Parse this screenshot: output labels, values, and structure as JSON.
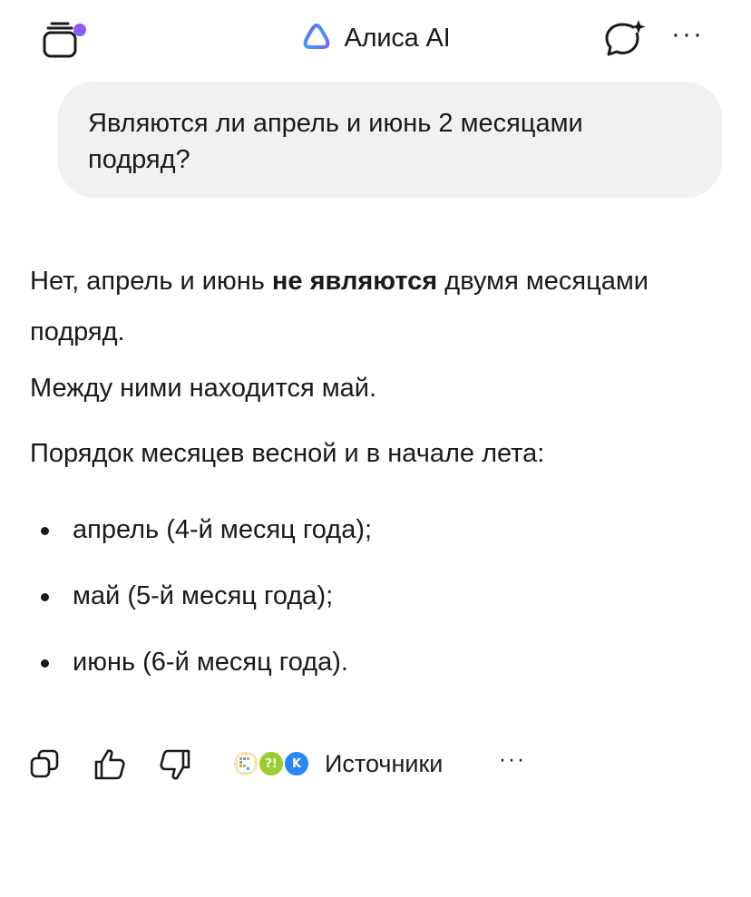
{
  "header": {
    "title": "Алиса AI",
    "chats_icon": "chats-stack-icon",
    "logo_icon": "alice-logo-icon",
    "new_chat_icon": "new-chat-sparkle-icon",
    "more_label": "···",
    "accent_color": "#8b5cf6"
  },
  "user_message": {
    "text": "Являются ли апрель и июнь 2 месяцами подряд?"
  },
  "answer": {
    "para1_before": "Нет, апрель и июнь ",
    "para1_bold": "не являются",
    "para1_after": " двумя месяцами подряд.",
    "para2": "Между ними находится май.",
    "para3": "Порядок месяцев весной и в начале лета:",
    "bullets": [
      "апрель (4-й месяц года);",
      "май (5-й месяц года);",
      "июнь (6-й месяц года)."
    ]
  },
  "actions": {
    "copy_icon": "copy-icon",
    "like_icon": "thumbs-up-icon",
    "dislike_icon": "thumbs-down-icon",
    "sources_label": "Источники",
    "source_icons": [
      "source-site-icon",
      "source-quiz-icon",
      "vk-icon"
    ],
    "vk_glyph": "K",
    "quiz_glyph": "?!",
    "more_label": "···"
  }
}
